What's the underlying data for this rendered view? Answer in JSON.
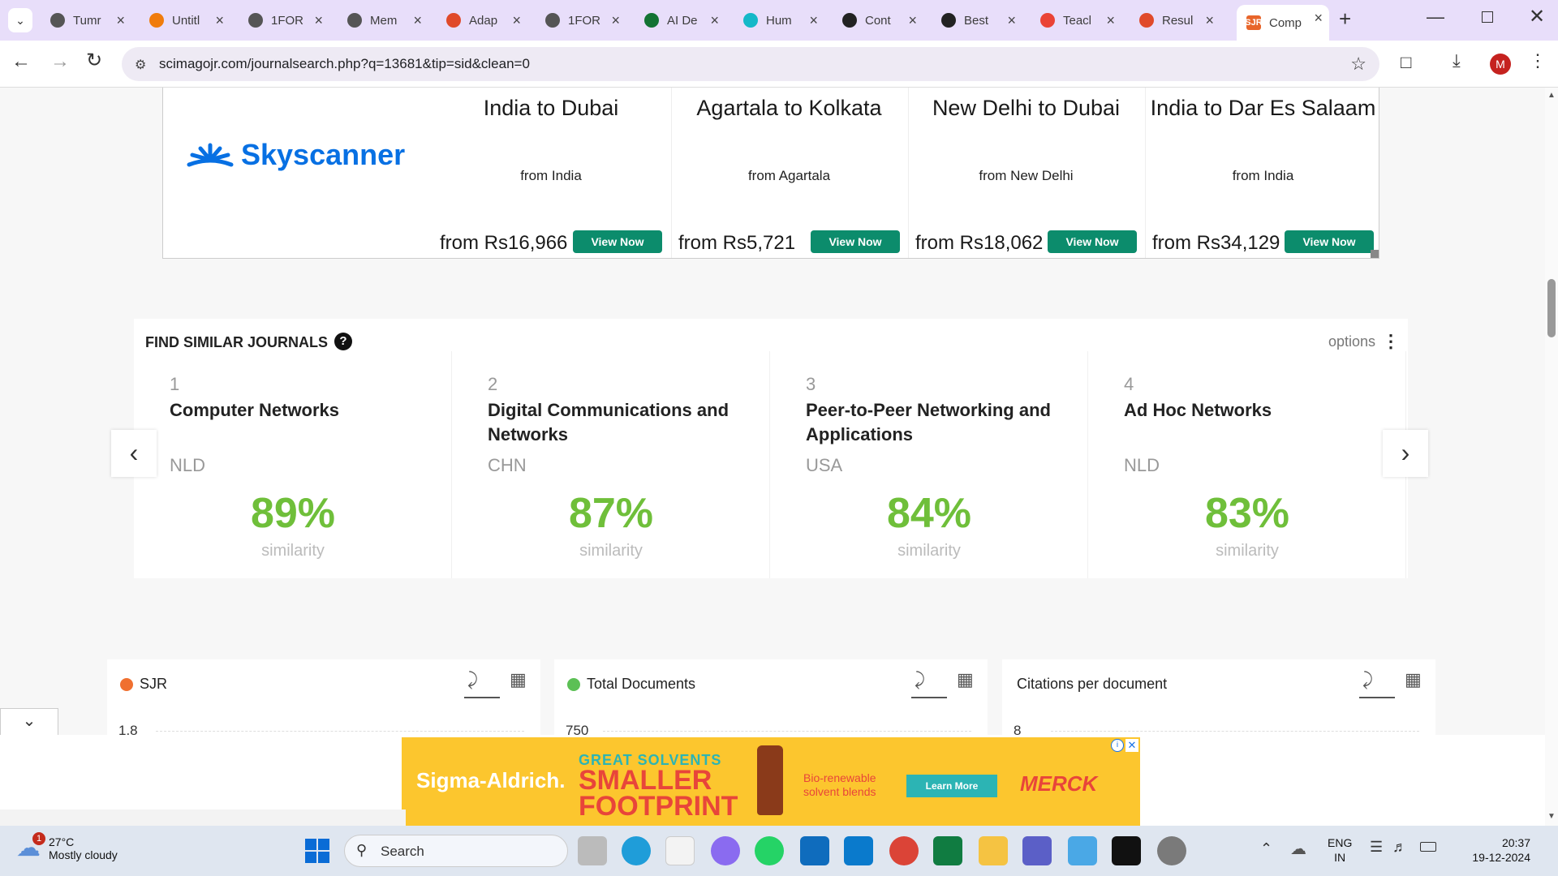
{
  "tabs": [
    {
      "title": "Tumr",
      "color": "#555"
    },
    {
      "title": "Untitl",
      "color": "#f07c0c"
    },
    {
      "title": "1FOR",
      "color": "#555"
    },
    {
      "title": "Mem",
      "color": "#555"
    },
    {
      "title": "Adap",
      "color": "#e04a2a"
    },
    {
      "title": "1FOR",
      "color": "#555"
    },
    {
      "title": "AI De",
      "color": "#137333"
    },
    {
      "title": "Hum",
      "color": "#14b8c8"
    },
    {
      "title": "Cont",
      "color": "#222"
    },
    {
      "title": "Best",
      "color": "#222"
    },
    {
      "title": "Teacl",
      "color": "#ea4335"
    },
    {
      "title": "Resul",
      "color": "#e04a2a"
    },
    {
      "title": "Comp",
      "color": "#e8652a",
      "fav_text": "SJR"
    }
  ],
  "browser": {
    "url": "scimagojr.com/journalsearch.php?q=13681&tip=sid&clean=0",
    "profile_initial": "M"
  },
  "skyscanner_ad": {
    "brand": "Skyscanner",
    "flights": [
      {
        "route": "India to Dubai",
        "from": "from India",
        "price": "from Rs16,966",
        "button": "View Now"
      },
      {
        "route": "Agartala to Kolkata",
        "from": "from Agartala",
        "price": "from Rs5,721",
        "button": "View Now"
      },
      {
        "route": "New Delhi to Dubai",
        "from": "from New Delhi",
        "price": "from Rs18,062",
        "button": "View Now"
      },
      {
        "route": "India to Dar Es Salaam",
        "from": "from India",
        "price": "from Rs34,129",
        "button": "View Now"
      }
    ]
  },
  "similar_journals": {
    "heading": "FIND SIMILAR JOURNALS",
    "help_icon": "?",
    "options_label": "options",
    "items": [
      {
        "rank": "1",
        "name": "Computer Networks",
        "country": "NLD",
        "similarity": "89%",
        "similarity_label": "similarity",
        "similarity_value": 0.89
      },
      {
        "rank": "2",
        "name": "Digital Communications and Networks",
        "country": "CHN",
        "similarity": "87%",
        "similarity_label": "similarity",
        "similarity_value": 0.87
      },
      {
        "rank": "3",
        "name": "Peer-to-Peer Networking and Applications",
        "country": "USA",
        "similarity": "84%",
        "similarity_label": "similarity",
        "similarity_value": 0.84
      },
      {
        "rank": "4",
        "name": "Ad Hoc Networks",
        "country": "NLD",
        "similarity": "83%",
        "similarity_label": "similarity",
        "similarity_value": 0.83
      }
    ]
  },
  "chart_panels": [
    {
      "title": "SJR",
      "dot_color": "#f07030",
      "first_tick": "1.8"
    },
    {
      "title": "Total Documents",
      "dot_color": "#5cc055",
      "first_tick": "750"
    },
    {
      "title": "Citations per document",
      "dot_color": "",
      "first_tick": "8"
    }
  ],
  "bottom_ad": {
    "brand": "Sigma-Aldrich.",
    "headline_top": "GREAT SOLVENTS",
    "headline_mid": "SMALLER",
    "headline_bot": "FOOTPRINT",
    "tagline": "Bio-renewable solvent blends",
    "button": "Learn More",
    "partner": "MERCK"
  },
  "taskbar": {
    "weather_temp": "27°C",
    "weather_desc": "Mostly cloudy",
    "weather_badge": "1",
    "search_placeholder": "Search",
    "lang_top": "ENG",
    "lang_bot": "IN",
    "time": "20:37",
    "date": "19-12-2024"
  }
}
